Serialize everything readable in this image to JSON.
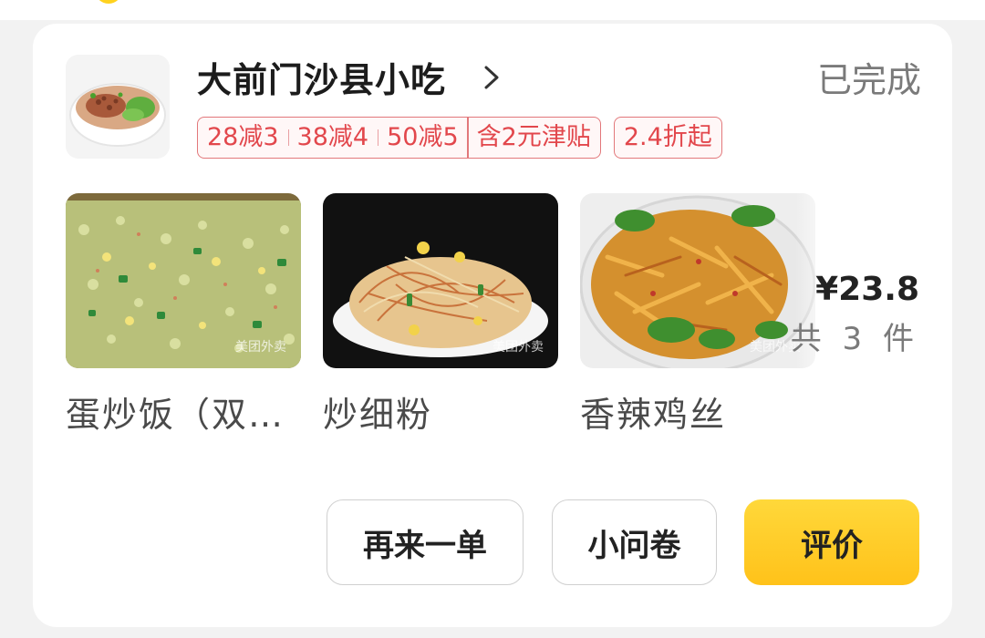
{
  "shop": {
    "name": "大前门沙县小吃",
    "status": "已完成"
  },
  "promotions": {
    "discounts": [
      "28减3",
      "38减4",
      "50减5"
    ],
    "subsidy": "含2元津贴",
    "discount_from": "2.4折起"
  },
  "items": [
    {
      "name": "蛋炒饭（双…",
      "image": "egg-fried-rice"
    },
    {
      "name": "炒细粉",
      "image": "fried-vermicelli"
    },
    {
      "name": "香辣鸡丝",
      "image": "spicy-shredded-chicken"
    }
  ],
  "watermark": "美团外卖",
  "summary": {
    "price": "¥23.8",
    "count": "共 3 件"
  },
  "actions": {
    "reorder": "再来一单",
    "survey": "小问卷",
    "review": "评价"
  },
  "colors": {
    "accent": "#ffc21a",
    "tag_red": "#e2474c",
    "status_gray": "#7a7a7a"
  }
}
